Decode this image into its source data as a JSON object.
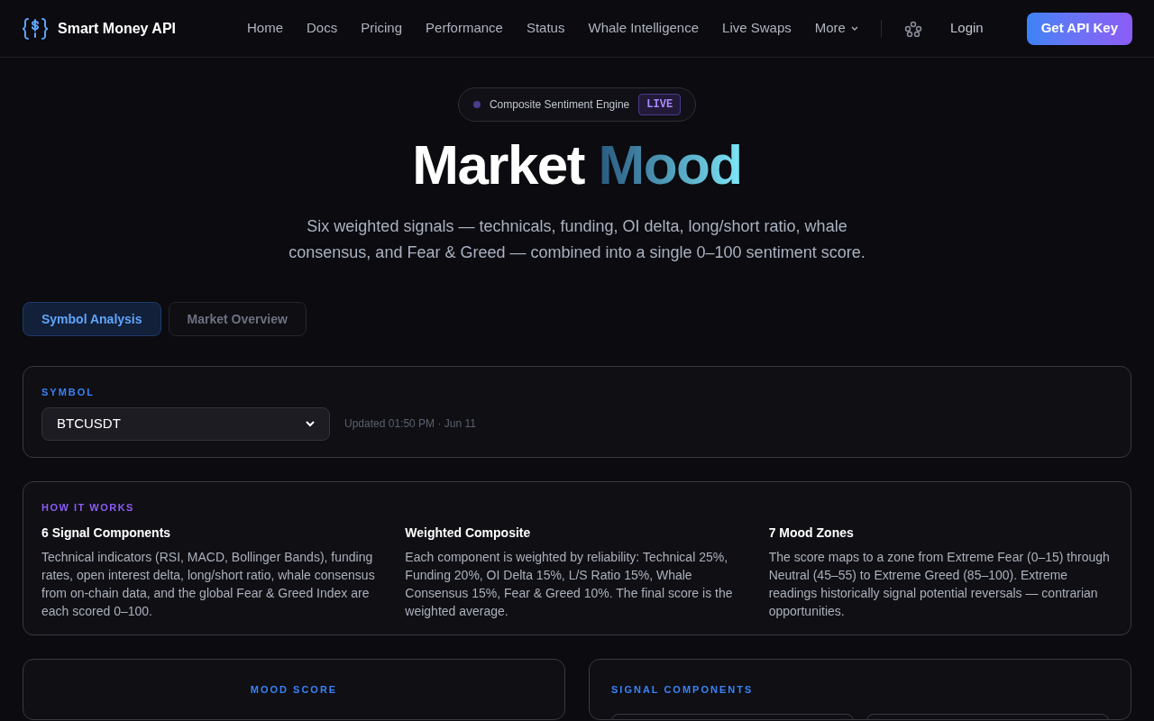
{
  "brand": {
    "name": "Smart Money API"
  },
  "nav": {
    "links": [
      {
        "label": "Home",
        "dropdown": false
      },
      {
        "label": "Docs",
        "dropdown": false
      },
      {
        "label": "Pricing",
        "dropdown": false
      },
      {
        "label": "Performance",
        "dropdown": false
      },
      {
        "label": "Status",
        "dropdown": false
      },
      {
        "label": "Whale Intelligence",
        "dropdown": false
      },
      {
        "label": "Live Swaps",
        "dropdown": false
      },
      {
        "label": "More",
        "dropdown": true
      }
    ],
    "login": "Login",
    "cta": "Get API Key"
  },
  "hero": {
    "badge": {
      "label": "Composite Sentiment Engine",
      "tag": "LIVE"
    },
    "title": "Market",
    "title_accent": "Mood",
    "subtitle": "Six weighted signals — technicals, funding, OI delta, long/short ratio, whale consensus, and Fear & Greed — combined into a single 0–100 sentiment score."
  },
  "tabs": [
    {
      "label": "Symbol Analysis",
      "selected": true
    },
    {
      "label": "Market Overview",
      "selected": false
    }
  ],
  "symbol": {
    "label": "SYMBOL",
    "value": "BTCUSDT",
    "updated": "Updated 01:50 PM · Jun 11"
  },
  "how_it_works": {
    "label": "HOW IT WORKS",
    "items": [
      {
        "title": "6 Signal Components",
        "text": "Technical indicators (RSI, MACD, Bollinger Bands), funding rates, open interest delta, long/short ratio, whale consensus from on-chain data, and the global Fear & Greed Index are each scored 0–100."
      },
      {
        "title": "Weighted Composite",
        "text": "Each component is weighted by reliability: Technical 25%, Funding 20%, OI Delta 15%, L/S Ratio 15%, Whale Consensus 15%, Fear & Greed 10%. The final score is the weighted average."
      },
      {
        "title": "7 Mood Zones",
        "text": "The score maps to a zone from Extreme Fear (0–15) through Neutral (45–55) to Extreme Greed (85–100). Extreme readings historically signal potential reversals — contrarian opportunities."
      }
    ]
  },
  "mood_score": {
    "label": "MOOD SCORE"
  },
  "signal_components": {
    "label": "SIGNAL COMPONENTS"
  }
}
